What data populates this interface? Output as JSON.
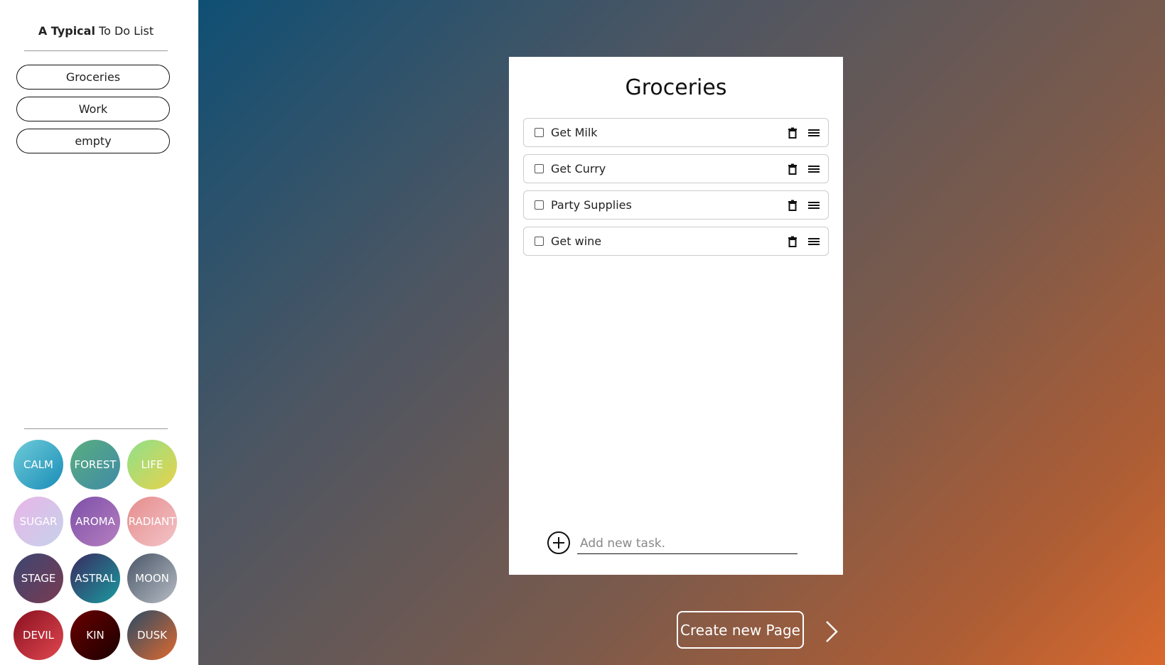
{
  "sidebar": {
    "title_bold": "A Typical",
    "title_rest": " To Do List",
    "pages": [
      {
        "label": "Groceries"
      },
      {
        "label": "Work"
      },
      {
        "label": "empty"
      }
    ],
    "themes": [
      {
        "label": "CALM",
        "color_from": "#6ecbd8",
        "color_to": "#1a8db8"
      },
      {
        "label": "FOREST",
        "color_from": "#5aae7e",
        "color_to": "#3f8aa8"
      },
      {
        "label": "LIFE",
        "color_from": "#8fe08a",
        "color_to": "#e8d24a"
      },
      {
        "label": "SUGAR",
        "color_from": "#e8b5e8",
        "color_to": "#c6d2ea"
      },
      {
        "label": "AROMA",
        "color_from": "#7b4fa8",
        "color_to": "#b77fc0"
      },
      {
        "label": "RADIANT",
        "color_from": "#e68c8c",
        "color_to": "#f2c4c8"
      },
      {
        "label": "STAGE",
        "color_from": "#3c4672",
        "color_to": "#7a3b52"
      },
      {
        "label": "ASTRAL",
        "color_from": "#3a2a5e",
        "color_to": "#1a9aa0"
      },
      {
        "label": "MOON",
        "color_from": "#4a5668",
        "color_to": "#b6bcc4"
      },
      {
        "label": "DEVIL",
        "color_from": "#8a1020",
        "color_to": "#e04850"
      },
      {
        "label": "KIN",
        "color_from": "#6a0000",
        "color_to": "#1a0000"
      },
      {
        "label": "DUSK",
        "color_from": "#2a4a66",
        "color_to": "#e06a2e"
      }
    ]
  },
  "card": {
    "title": "Groceries",
    "tasks": [
      {
        "label": "Get Milk"
      },
      {
        "label": "Get Curry"
      },
      {
        "label": "Party Supplies"
      },
      {
        "label": "Get wine"
      }
    ],
    "add_placeholder": "Add new task."
  },
  "footer": {
    "create_label": "Create new Page"
  }
}
